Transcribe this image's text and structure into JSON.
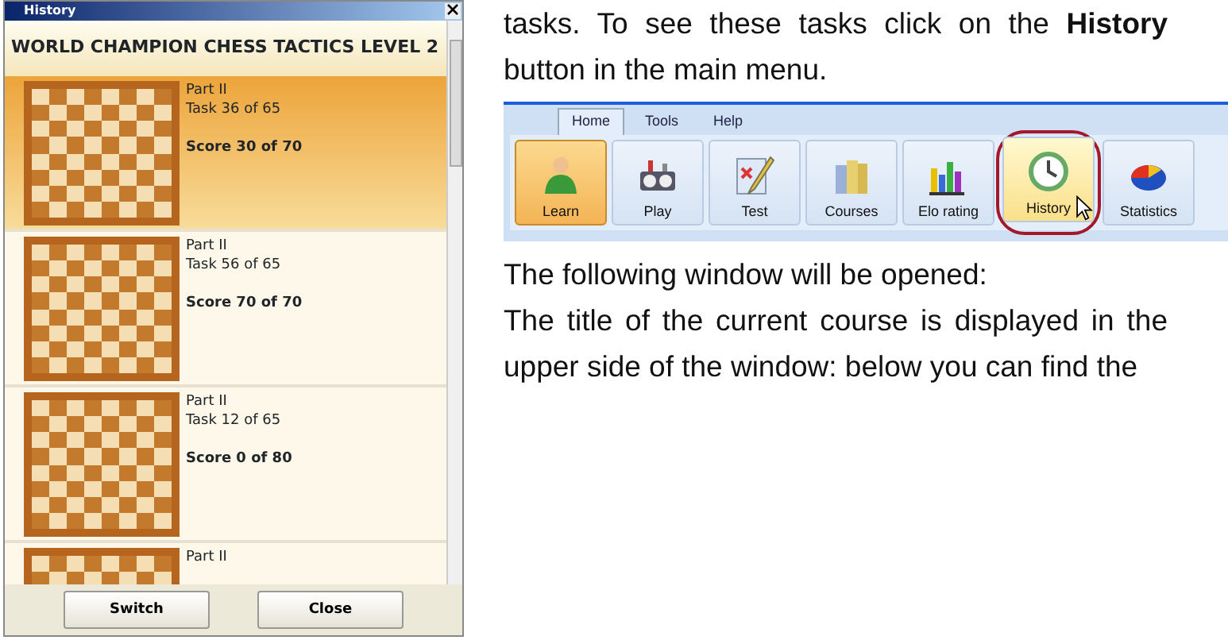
{
  "history_window": {
    "title": "History",
    "course_title": "WORLD CHAMPION CHESS TACTICS LEVEL 2",
    "entries": [
      {
        "part": "Part II",
        "task": "Task 36 of 65",
        "score": "Score 30 of 70",
        "selected": true
      },
      {
        "part": "Part II",
        "task": "Task 56 of 65",
        "score": "Score 70 of 70",
        "selected": false
      },
      {
        "part": "Part II",
        "task": "Task 12 of 65",
        "score": "Score 0 of 80",
        "selected": false
      },
      {
        "part": "Part II",
        "selected": false
      }
    ],
    "buttons": [
      "Switch",
      "Close"
    ]
  },
  "document": {
    "paragraphs": [
      "tasks. To see these tasks click on the **History** button in the main menu.",
      "The following window will be opened:",
      "The title of the current course is displayed in the upper side of the window: below you can find the"
    ],
    "ribbon": {
      "tabs": [
        {
          "label": "Home",
          "selected": true
        },
        {
          "label": "Tools",
          "selected": false
        },
        {
          "label": "Help",
          "selected": false
        }
      ],
      "buttons": [
        {
          "label": "Learn",
          "kind": "learn",
          "selected": true,
          "hover": false,
          "circled": false
        },
        {
          "label": "Play",
          "kind": "play",
          "selected": false,
          "hover": false,
          "circled": false
        },
        {
          "label": "Test",
          "kind": "test",
          "selected": false,
          "hover": false,
          "circled": false
        },
        {
          "label": "Courses",
          "kind": "courses",
          "selected": false,
          "hover": false,
          "circled": false
        },
        {
          "label": "Elo rating",
          "kind": "elo",
          "selected": false,
          "hover": false,
          "circled": false
        },
        {
          "label": "History",
          "kind": "history",
          "selected": false,
          "hover": true,
          "circled": true
        },
        {
          "label": "Statistics",
          "kind": "statistics",
          "selected": false,
          "hover": false,
          "circled": false
        }
      ]
    }
  }
}
